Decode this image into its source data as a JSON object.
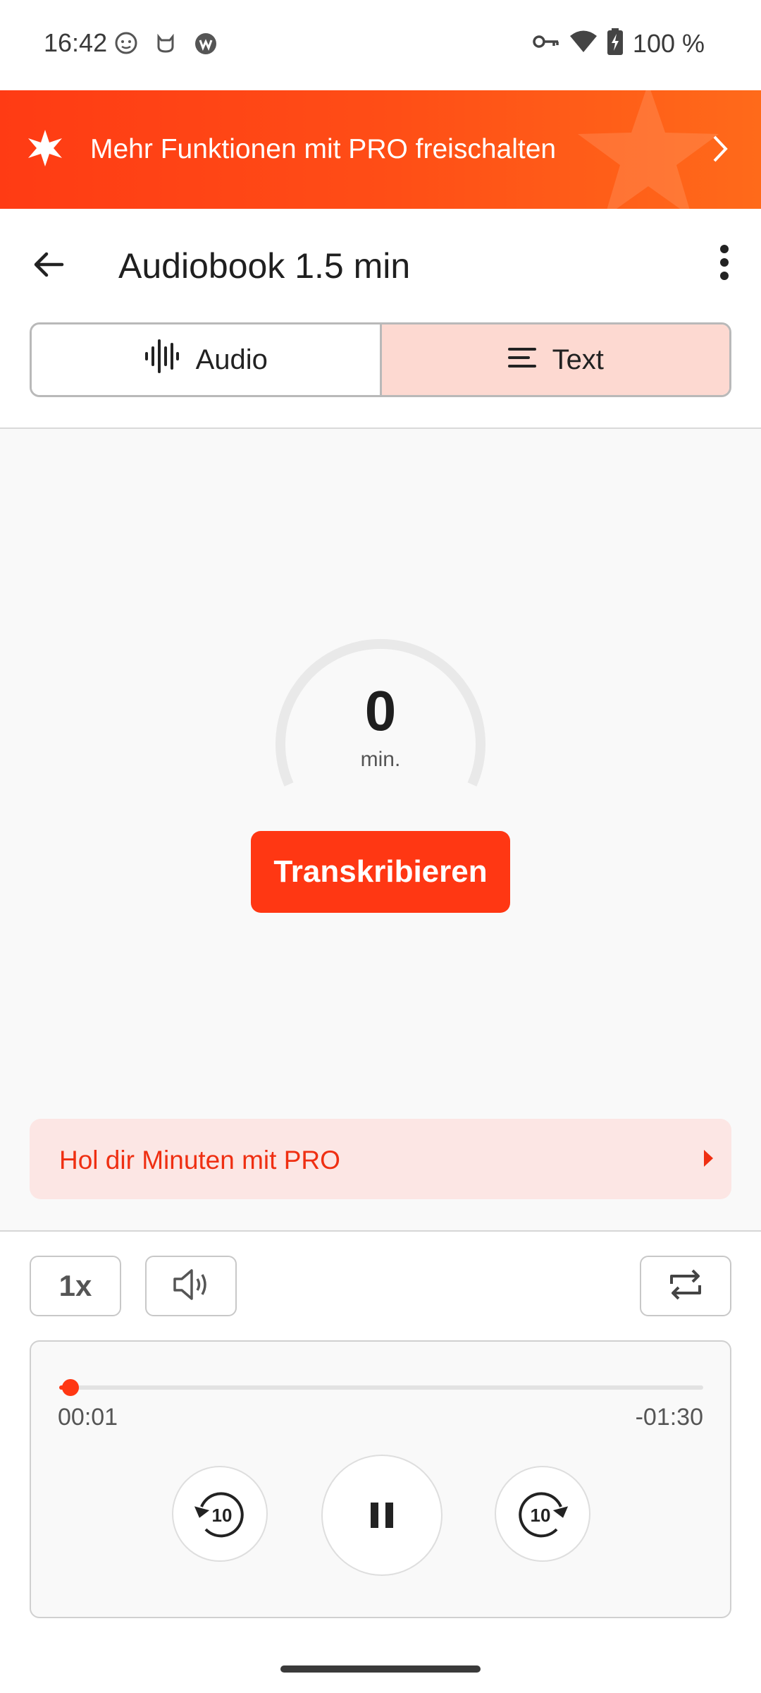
{
  "status_bar": {
    "time": "16:42",
    "battery": "100 %",
    "left_icons": [
      "face-notification-icon",
      "cat-notification-icon",
      "app-notification-icon"
    ],
    "right_icons": [
      "vpn-key-icon",
      "wifi-icon",
      "battery-charging-icon"
    ]
  },
  "pro_banner": {
    "text": "Mehr Funktionen mit PRO freischalten",
    "color": "#ff4d16"
  },
  "app_bar": {
    "title": "Audiobook 1.5 min"
  },
  "tabs": {
    "audio_label": "Audio",
    "text_label": "Text",
    "selected": "Text"
  },
  "gauge": {
    "value": "0",
    "unit": "min."
  },
  "transcribe_button": "Transkribieren",
  "pro_minutes": {
    "label": "Hol dir Minuten mit PRO"
  },
  "controls": {
    "speed": "1x"
  },
  "player": {
    "elapsed": "00:01",
    "remaining": "-01:30",
    "progress_fraction": 0.011,
    "skip_seconds": "10"
  },
  "colors": {
    "accent": "#ff3713",
    "tab_selected_bg": "#fdd9d1",
    "pro_card_bg": "#fce6e4"
  }
}
